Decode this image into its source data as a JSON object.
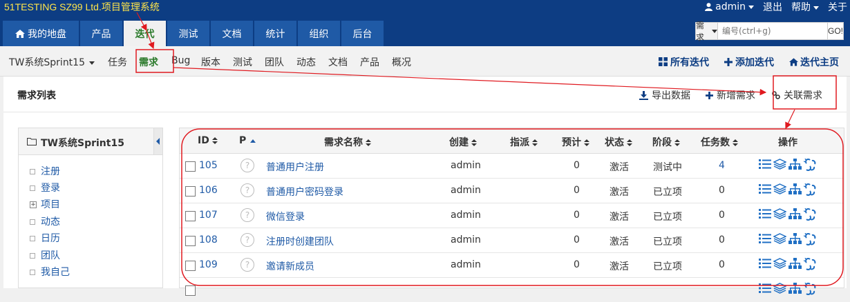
{
  "header": {
    "brand": "51TESTING SZ99 Ltd.项目管理系统",
    "user": "admin",
    "logout": "退出",
    "help": "帮助",
    "about": "关于",
    "tabs": [
      "我的地盘",
      "产品",
      "迭代",
      "测试",
      "文档",
      "统计",
      "组织",
      "后台"
    ],
    "active_tab": "迭代",
    "search": {
      "type": "需求",
      "placeholder": "编号(ctrl+g)",
      "go": "GO!"
    }
  },
  "subnav": {
    "project": "TW系统Sprint15",
    "items": [
      "任务",
      "需求",
      "Bug",
      "版本",
      "测试",
      "团队",
      "动态",
      "文档",
      "产品",
      "概况"
    ],
    "active": "需求",
    "right": [
      "所有迭代",
      "添加迭代",
      "迭代主页"
    ]
  },
  "panel": {
    "title": "需求列表",
    "actions": [
      "导出数据",
      "新增需求",
      "关联需求"
    ]
  },
  "tree": {
    "title": "TW系统Sprint15",
    "items": [
      "注册",
      "登录",
      "项目",
      "动态",
      "日历",
      "团队",
      "我自己"
    ]
  },
  "table": {
    "headers": [
      "ID",
      "P",
      "需求名称",
      "创建",
      "指派",
      "预计",
      "状态",
      "阶段",
      "任务数",
      "操作"
    ],
    "rows": [
      {
        "id": "105",
        "p": "?",
        "name": "普通用户注册",
        "creator": "admin",
        "assign": "",
        "est": "0",
        "status": "激活",
        "stage": "测试中",
        "tasks": "4"
      },
      {
        "id": "106",
        "p": "?",
        "name": "普通用户密码登录",
        "creator": "admin",
        "assign": "",
        "est": "0",
        "status": "激活",
        "stage": "已立项",
        "tasks": "0"
      },
      {
        "id": "107",
        "p": "?",
        "name": "微信登录",
        "creator": "admin",
        "assign": "",
        "est": "0",
        "status": "激活",
        "stage": "已立项",
        "tasks": "0"
      },
      {
        "id": "108",
        "p": "?",
        "name": "注册时创建团队",
        "creator": "admin",
        "assign": "",
        "est": "0",
        "status": "激活",
        "stage": "已立项",
        "tasks": "0"
      },
      {
        "id": "109",
        "p": "?",
        "name": "邀请新成员",
        "creator": "admin",
        "assign": "",
        "est": "0",
        "status": "激活",
        "stage": "已立项",
        "tasks": "0"
      }
    ]
  },
  "colors": {
    "header": "#0d3d83",
    "brand": "#ffe54a",
    "accent": "#2b7a2b",
    "annotation": "#e0191f"
  }
}
